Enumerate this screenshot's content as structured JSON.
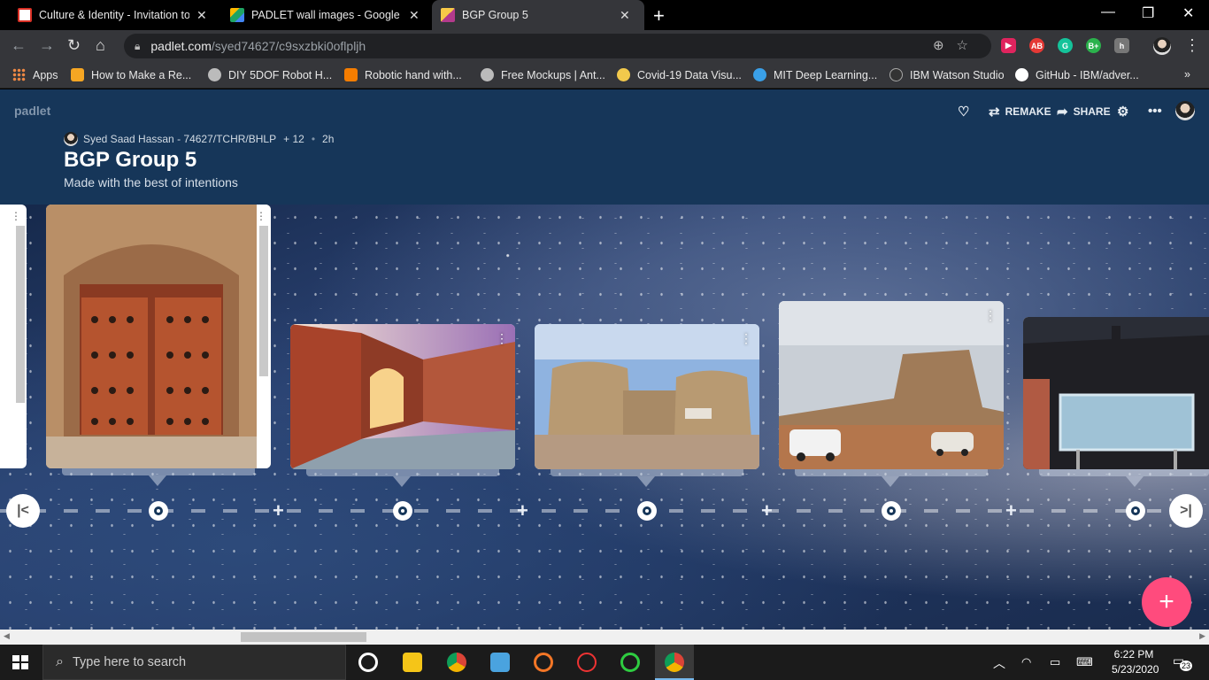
{
  "tabs": [
    {
      "title": "Culture & Identity - Invitation to",
      "favicon": "gmail-icon",
      "color": "#d93025"
    },
    {
      "title": "PADLET wall images - Google Dri",
      "favicon": "google-drive-icon",
      "color": "#1fa463"
    },
    {
      "title": "BGP Group 5",
      "favicon": "padlet-icon",
      "color": "#b33a8c"
    }
  ],
  "address": {
    "host": "padlet.com",
    "path": "/syed74627/c9sxzbki0oflpljh"
  },
  "bookmarks": [
    {
      "label": "Apps"
    },
    {
      "label": "How to Make a Re..."
    },
    {
      "label": "DIY 5DOF Robot H..."
    },
    {
      "label": "Robotic hand with..."
    },
    {
      "label": "Free Mockups | Ant..."
    },
    {
      "label": "Covid-19 Data Visu..."
    },
    {
      "label": "MIT Deep Learning..."
    },
    {
      "label": "IBM Watson Studio"
    },
    {
      "label": "GitHub - IBM/adver..."
    }
  ],
  "padlet": {
    "logo": "padlet",
    "actions": {
      "remake": "REMAKE",
      "share": "SHARE"
    },
    "author": "Syed Saad Hassan - 74627/TCHR/BHLP",
    "likes": "+ 12",
    "age": "2h",
    "title": "BGP Group 5",
    "subtitle": "Made with the best of intentions"
  },
  "taskbar": {
    "search_placeholder": "Type here to search",
    "time": "6:22 PM",
    "date": "5/23/2020",
    "notifications": "23"
  },
  "colors": {
    "header": "#163659",
    "fab": "#ff4b7d"
  }
}
